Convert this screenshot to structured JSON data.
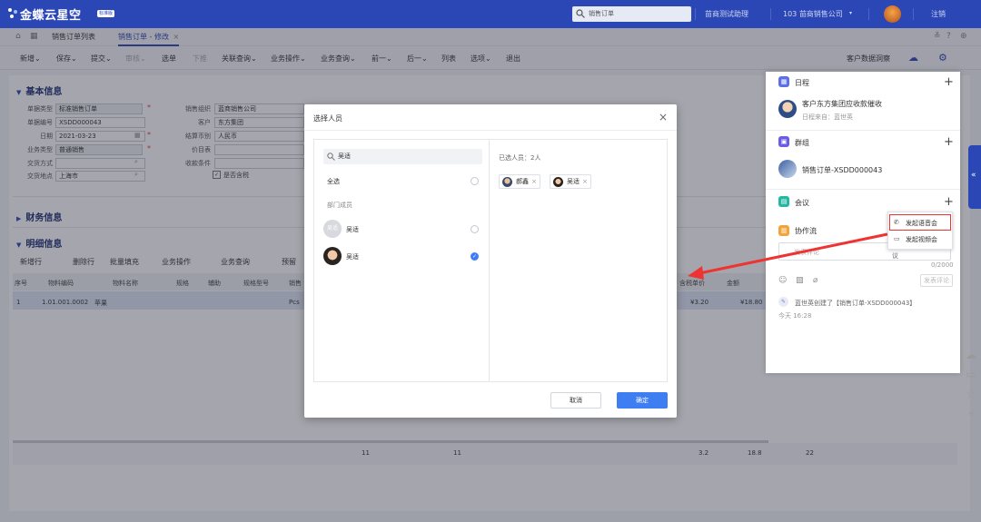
{
  "app": {
    "logo_text": "金蝶云星空",
    "badge": "标准版"
  },
  "topbar": {
    "search_value": "销售订单",
    "env": "苗商测试助理",
    "org": "103 苗商销售公司",
    "logout": "注销"
  },
  "tabs": {
    "list": "销售订单列表",
    "edit": "销售订单 - 修改",
    "close": "×"
  },
  "toolbar": {
    "buttons": [
      "新增",
      "保存",
      "提交",
      "审核",
      "选单",
      "下推",
      "关联查询",
      "业务操作",
      "业务查询",
      "前一",
      "后一",
      "列表",
      "选项",
      "退出"
    ],
    "right": "客户数据洞察"
  },
  "basic": {
    "title": "基本信息",
    "fields": [
      {
        "label": "单据类型",
        "value": "标准销售订单"
      },
      {
        "label": "单据编号",
        "value": "XSDD000043"
      },
      {
        "label": "日期",
        "value": "2021-03-23"
      },
      {
        "label": "业务类型",
        "value": "普通销售"
      },
      {
        "label": "交货方式",
        "value": ""
      },
      {
        "label": "交货地点",
        "value": "上海市"
      },
      {
        "label": "销售组织",
        "value": "蓝商销售公司"
      },
      {
        "label": "客户",
        "value": "东方集团"
      },
      {
        "label": "结算币别",
        "value": "人民币"
      },
      {
        "label": "价目表",
        "value": ""
      },
      {
        "label": "收款条件",
        "value": ""
      }
    ],
    "checkbox": "是否含税"
  },
  "finance": {
    "title": "财务信息"
  },
  "detail": {
    "title": "明细信息",
    "toolbar": [
      "新增行",
      "删除行",
      "批量填充",
      "业务操作",
      "业务查询",
      "预留"
    ],
    "columns": [
      "序号",
      "物料编码",
      "物料名称",
      "规格",
      "辅助",
      "规格型号",
      "销售",
      "含税单价",
      "金额"
    ],
    "row": {
      "seq": "1",
      "code": "1.01.001.0002",
      "name": "苹果",
      "unit": "Pcs",
      "price": "¥3.20",
      "amount": "¥18.80"
    },
    "summary": [
      "11",
      "11",
      "3.2",
      "18.8",
      "22"
    ]
  },
  "dialog": {
    "title": "选择人员",
    "search_value": "吴适",
    "select_all": "全选",
    "dept_members": "部门成员",
    "members": [
      {
        "name": "吴适",
        "avatar": "吴适",
        "checked": false
      },
      {
        "name": "吴适",
        "avatar": "",
        "checked": true
      }
    ],
    "selected_label": "已选人员：2人",
    "selected": [
      "郝鑫",
      "吴适"
    ],
    "cancel": "取消",
    "ok": "确定"
  },
  "rpanel": {
    "schedule": {
      "title": "日程",
      "item": "客户东方集团应收款催收",
      "sub": "日程来自：蓝世英"
    },
    "group": {
      "title": "群组",
      "item": "销售订单-XSDD000043"
    },
    "meeting": {
      "title": "会议"
    },
    "collab": {
      "title": "协作流",
      "placeholder": "发表评论",
      "counter": "0/2000",
      "post": "发表评论",
      "log": "蓝世英创建了【销售订单-XSDD000043】",
      "time": "今天 16:28",
      "tail": "议"
    },
    "menu": {
      "voice": "发起语音会",
      "video": "发起视频会"
    }
  },
  "colors": {
    "brand": "#2b47b6",
    "primary": "#3e7ef2",
    "highlight": "#e33333"
  }
}
